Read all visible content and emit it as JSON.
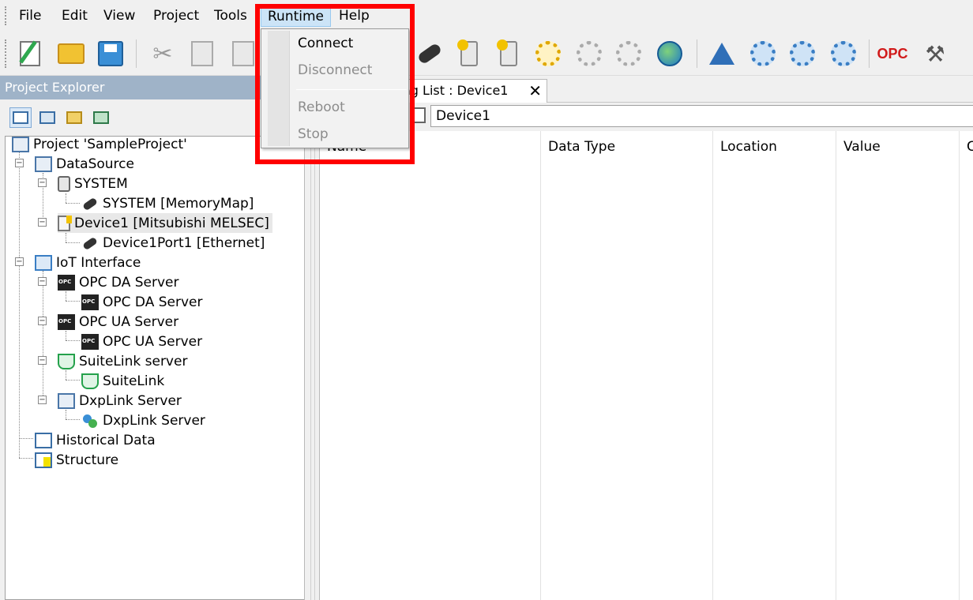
{
  "menubar": {
    "items": [
      {
        "label": "File"
      },
      {
        "label": "Edit"
      },
      {
        "label": "View"
      },
      {
        "label": "Project"
      },
      {
        "label": "Tools"
      },
      {
        "label": "Runtime"
      },
      {
        "label": "Help"
      }
    ]
  },
  "toolbar": {
    "opc_label": "OPC",
    "icons": [
      "new-project-icon",
      "open-folder-icon",
      "save-icon",
      "cut-icon",
      "copy-icon",
      "paste-icon",
      "connect-plug-icon",
      "device-icon",
      "device-config-icon",
      "gear-icon",
      "disconnect-icon",
      "disconnected-plug-icon",
      "globe-icon",
      "wizard-icon",
      "gear-blue-icon",
      "gear-search-icon",
      "gear-settings-icon",
      "opc-icon",
      "tools-icon"
    ]
  },
  "dropdown": {
    "items": [
      {
        "label": "Connect",
        "enabled": true
      },
      {
        "label": "Disconnect",
        "enabled": false
      },
      {
        "label": "Reboot",
        "enabled": false
      },
      {
        "label": "Stop",
        "enabled": false
      }
    ]
  },
  "explorer": {
    "title": "Project Explorer",
    "tree": [
      {
        "label": "Project 'SampleProject'",
        "icon": "project-icon"
      },
      {
        "label": "DataSource",
        "icon": "datasource-icon"
      },
      {
        "label": "SYSTEM",
        "icon": "system-device-icon"
      },
      {
        "label": "SYSTEM [MemoryMap]",
        "icon": "plug-icon"
      },
      {
        "label": "Device1 [Mitsubishi MELSEC]",
        "icon": "device-icon"
      },
      {
        "label": "Device1Port1 [Ethernet]",
        "icon": "plug-icon"
      },
      {
        "label": "IoT Interface",
        "icon": "iot-icon"
      },
      {
        "label": "OPC DA Server",
        "icon": "opc-server-icon"
      },
      {
        "label": "OPC DA Server",
        "icon": "opc-da-icon"
      },
      {
        "label": "OPC UA Server",
        "icon": "opc-server-icon"
      },
      {
        "label": "OPC UA Server",
        "icon": "opc-ua-icon"
      },
      {
        "label": "SuiteLink server",
        "icon": "suitelink-server-icon"
      },
      {
        "label": "SuiteLink",
        "icon": "suitelink-icon"
      },
      {
        "label": "DxpLink Server",
        "icon": "dxplink-server-icon"
      },
      {
        "label": "DxpLink Server",
        "icon": "dxplink-icon"
      },
      {
        "label": "Historical Data",
        "icon": "historical-data-icon"
      },
      {
        "label": "Structure",
        "icon": "structure-icon"
      }
    ]
  },
  "document": {
    "tab_label": "ag List : Device1",
    "close_glyph": "✕",
    "path": "Device1",
    "columns": [
      {
        "label": "Name"
      },
      {
        "label": "Data Type"
      },
      {
        "label": "Location"
      },
      {
        "label": "Value"
      },
      {
        "label": "C"
      }
    ]
  },
  "colors": {
    "highlight": "#ff0000",
    "menu_active": "#cce4f7",
    "explorer_title_bg": "#9fb3c8"
  }
}
